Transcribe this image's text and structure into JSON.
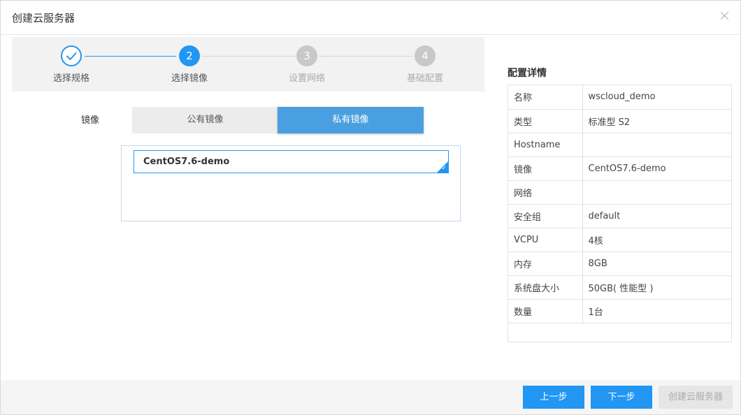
{
  "dialog": {
    "title": "创建云服务器"
  },
  "steps": [
    {
      "number": "1",
      "label": "选择规格",
      "state": "done"
    },
    {
      "number": "2",
      "label": "选择镜像",
      "state": "active"
    },
    {
      "number": "3",
      "label": "设置网络",
      "state": "todo"
    },
    {
      "number": "4",
      "label": "基础配置",
      "state": "todo"
    }
  ],
  "image": {
    "label": "镜像",
    "tabs": [
      {
        "label": "公有镜像"
      },
      {
        "label": "私有镜像"
      }
    ],
    "selected_tab": "私有镜像",
    "items": [
      {
        "name": "CentOS7.6-demo"
      }
    ]
  },
  "details": {
    "title": "配置详情",
    "rows": [
      {
        "key": "名称",
        "value": "wscloud_demo"
      },
      {
        "key": "类型",
        "value": "标准型 S2"
      },
      {
        "key": "Hostname",
        "value": ""
      },
      {
        "key": "镜像",
        "value": "CentOS7.6-demo"
      },
      {
        "key": "网络",
        "value": ""
      },
      {
        "key": "安全组",
        "value": "default"
      },
      {
        "key": "VCPU",
        "value": "4核"
      },
      {
        "key": "内存",
        "value": "8GB"
      },
      {
        "key": "系统盘大小",
        "value": "50GB( 性能型 )"
      },
      {
        "key": "数量",
        "value": "1台"
      }
    ]
  },
  "footer": {
    "prev_label": "上一步",
    "next_label": "下一步",
    "create_label": "创建云服务器"
  },
  "colors": {
    "primary": "#2196f3",
    "tab_active": "#4a9fe0",
    "disabled": "#e6e6e6"
  }
}
